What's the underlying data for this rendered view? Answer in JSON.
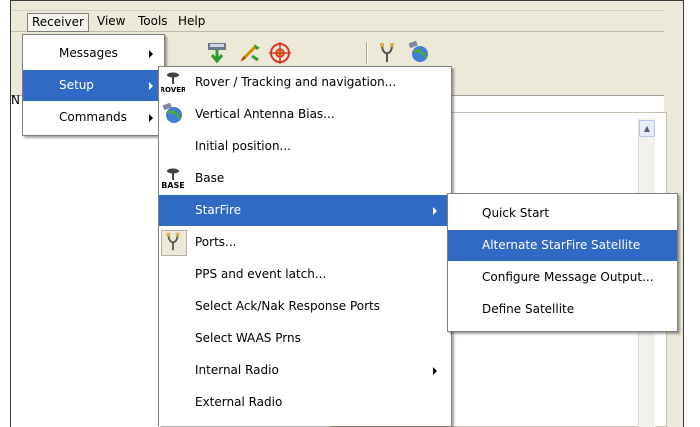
{
  "menubar": {
    "items": [
      "Receiver",
      "View",
      "Tools",
      "Help"
    ]
  },
  "background": {
    "n_label": "N"
  },
  "receiver_menu": {
    "items": [
      {
        "label": "Messages",
        "submenu": true,
        "selected": false
      },
      {
        "label": "Setup",
        "submenu": true,
        "selected": true
      },
      {
        "label": "Commands",
        "submenu": true,
        "selected": false
      }
    ]
  },
  "setup_menu": {
    "items": [
      {
        "label": "Rover / Tracking and navigation...",
        "icon": "rover-icon",
        "icon_text": "ROVER"
      },
      {
        "label": "Vertical Antenna Bias...",
        "icon": "globe-satellite-icon"
      },
      {
        "label": "Initial position...",
        "icon": ""
      },
      {
        "label": "Base",
        "icon": "base-icon",
        "icon_text": "BASE"
      },
      {
        "label": "StarFire",
        "icon": "",
        "submenu": true,
        "selected": true
      },
      {
        "label": "Ports...",
        "icon": "port-cable-icon"
      },
      {
        "label": "PPS and event latch...",
        "icon": ""
      },
      {
        "label": "Select Ack/Nak Response Ports",
        "icon": ""
      },
      {
        "label": "Select WAAS Prns",
        "icon": ""
      },
      {
        "label": "Internal Radio",
        "icon": "",
        "submenu": true
      },
      {
        "label": "External Radio",
        "icon": ""
      }
    ]
  },
  "starfire_menu": {
    "items": [
      {
        "label": "Quick Start",
        "selected": false
      },
      {
        "label": "Alternate StarFire Satellite",
        "selected": true
      },
      {
        "label": "Configure Message Output...",
        "selected": false
      },
      {
        "label": "Define Satellite",
        "selected": false
      }
    ]
  },
  "colors": {
    "highlight": "#316ac5",
    "window_bg": "#ece9d8"
  }
}
